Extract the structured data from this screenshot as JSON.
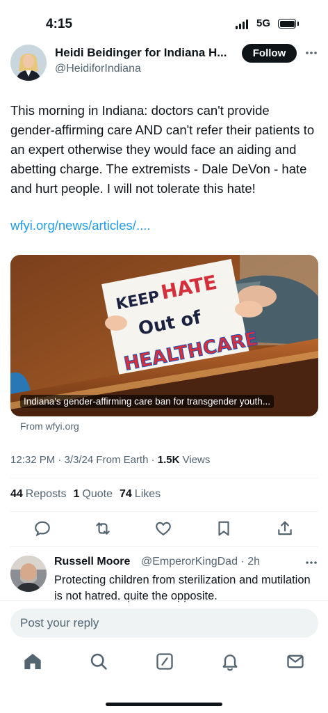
{
  "status": {
    "time": "4:15",
    "network": "5G"
  },
  "tweet": {
    "author_name": "Heidi Beidinger for Indiana H...",
    "author_handle": "@HeidiforIndiana",
    "follow_label": "Follow",
    "text": "This morning in Indiana: doctors can't provide gender-affirming care AND can't refer their patients to an expert otherwise they would face an aiding and abetting charge. The extremists - Dale DeVon - hate and hurt people. I will not tolerate this hate!",
    "link": "wfyi.org/news/articles/....",
    "media": {
      "sign_line1": "KEEP",
      "sign_line1b": "HATE",
      "sign_line2": "Out of",
      "sign_line3": "HEALTHCARE",
      "caption": "Indiana's gender-affirming care ban for transgender youth...",
      "source": "From wfyi.org"
    },
    "timestamp": "12:32 PM · 3/3/24 From Earth · ",
    "views_count": "1.5K",
    "views_label": "Views",
    "reposts_count": "44",
    "reposts_label": "Reposts",
    "quotes_count": "1",
    "quotes_label": "Quote",
    "likes_count": "74",
    "likes_label": "Likes"
  },
  "reply": {
    "name": "Russell Moore",
    "handle_time": "@EmperorKingDad · 2h",
    "text": "Protecting children from sterilization and mutilation is not hatred, quite the opposite."
  },
  "composer": {
    "placeholder": "Post your reply"
  },
  "icons": {
    "actions": [
      "reply-icon",
      "repost-icon",
      "like-icon",
      "bookmark-icon",
      "share-icon"
    ],
    "tabs": [
      "home-icon",
      "search-icon",
      "grok-icon",
      "notifications-icon",
      "messages-icon"
    ]
  },
  "colors": {
    "link": "#1d9bf0",
    "text": "#0f1419",
    "secondary": "#536471",
    "follow_bg": "#0f1419"
  }
}
